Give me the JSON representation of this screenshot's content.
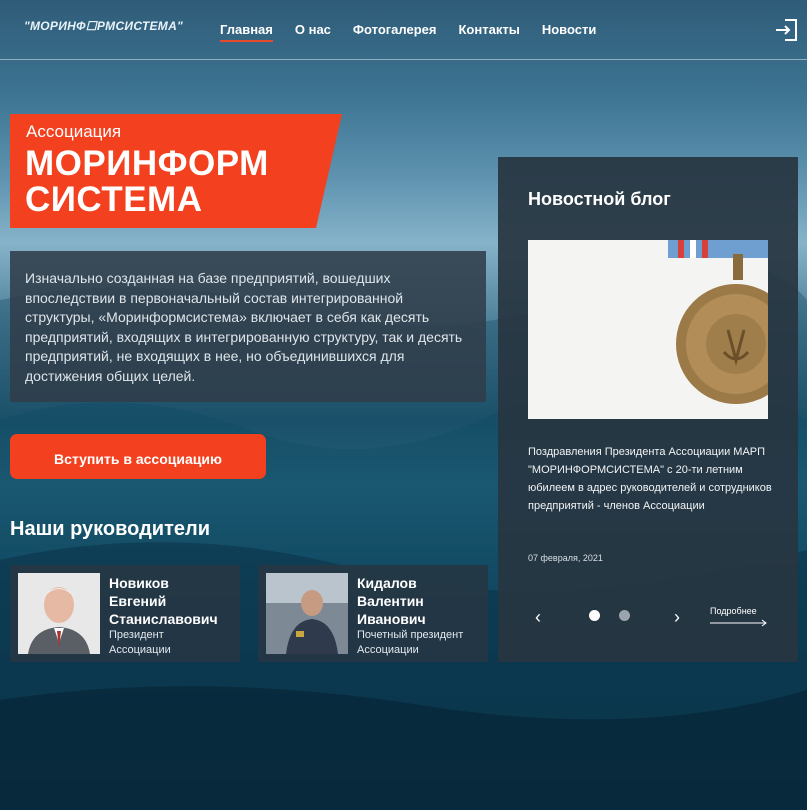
{
  "header": {
    "logo_text": "\"МОРИНФ☐РМСИСТЕМА\"",
    "nav": [
      {
        "label": "Главная",
        "active": true
      },
      {
        "label": "О нас",
        "active": false
      },
      {
        "label": "Фотогалерея",
        "active": false
      },
      {
        "label": "Контакты",
        "active": false
      },
      {
        "label": "Новости",
        "active": false
      }
    ],
    "login_icon": "login-icon"
  },
  "hero": {
    "subtitle": "Ассоциация",
    "title_line1": "МОРИНФОРМ",
    "title_line2": "СИСТЕМА",
    "description": "Изначально созданная на базе предприятий, вошедших впоследствии в первоначальный состав интегрированной структуры, «Моринформсистема» включает в себя как десять предприятий, входящих в интегрированную структуру, так и десять предприятий, не входящих в нее, но объединившихся для достижения общих целей.",
    "join_button": "Вступить в ассоциацию"
  },
  "leaders": {
    "title": "Наши руководители",
    "items": [
      {
        "name": "Новиков Евгений Станиславович",
        "name_l1": "Новиков",
        "name_l2": "Евгений",
        "name_l3": "Станиславович",
        "role_l1": "Президент",
        "role_l2": "Ассоциации"
      },
      {
        "name": "Кидалов Валентин Иванович",
        "name_l1": "Кидалов",
        "name_l2": "Валентин",
        "name_l3": "Иванович",
        "role_l1": "Почетный президент",
        "role_l2": "Ассоциации"
      }
    ]
  },
  "blog": {
    "title": "Новостной блог",
    "post_text": "Поздравления Президента Ассоциации МАРП \"МОРИНФОРМСИСТЕМА\" с 20-ти летним юбилеем в адрес руководителей и сотрудников предприятий - членов Ассоциации",
    "post_date": "07 февраля, 2021",
    "prev": "‹",
    "next": "›",
    "more_label": "Подробнее",
    "slides_total": 2,
    "slide_active": 1
  },
  "colors": {
    "accent": "#f3411f",
    "panel": "#2e3e4a"
  }
}
